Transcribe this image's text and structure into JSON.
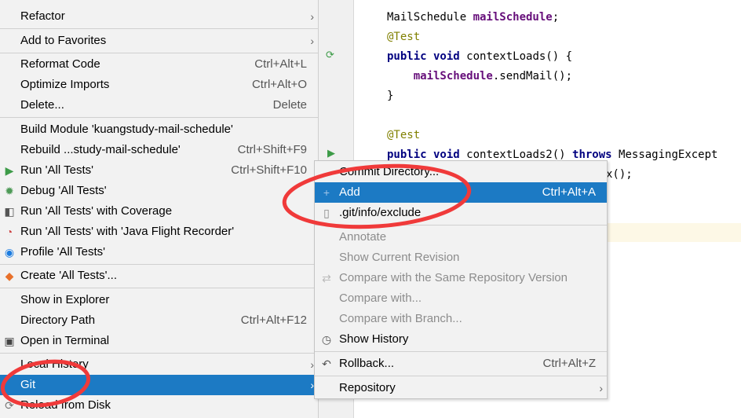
{
  "editor": {
    "lines": [
      {
        "parts": [
          {
            "t": "MailSchedule ",
            "c": ""
          },
          {
            "t": "mailSchedule",
            "c": "fld"
          },
          {
            "t": ";",
            "c": ""
          }
        ]
      },
      {
        "parts": [
          {
            "t": "@Test",
            "c": "ann"
          }
        ]
      },
      {
        "parts": [
          {
            "t": "public void ",
            "c": "kw"
          },
          {
            "t": "contextLoads() {",
            "c": ""
          }
        ]
      },
      {
        "parts": [
          {
            "t": "    ",
            "c": ""
          },
          {
            "t": "mailSchedule",
            "c": "fld"
          },
          {
            "t": ".sendMail();",
            "c": ""
          }
        ]
      },
      {
        "parts": [
          {
            "t": "}",
            "c": ""
          }
        ]
      },
      {
        "parts": [
          {
            "t": "@Test",
            "c": "ann"
          }
        ]
      },
      {
        "parts": [
          {
            "t": "public void ",
            "c": "kw"
          },
          {
            "t": "contextLoads2() ",
            "c": ""
          },
          {
            "t": "throws ",
            "c": "kw"
          },
          {
            "t": "MessagingExcept",
            "c": ""
          }
        ]
      },
      {
        "parts": [
          {
            "t": "x();",
            "c": ""
          }
        ]
      }
    ]
  },
  "context_menu": {
    "items": [
      {
        "label": "Refactor",
        "submenu": true
      },
      {
        "separator": true
      },
      {
        "label": "Add to Favorites",
        "submenu": true
      },
      {
        "separator": true
      },
      {
        "label": "Reformat Code",
        "shortcut": "Ctrl+Alt+L"
      },
      {
        "label": "Optimize Imports",
        "shortcut": "Ctrl+Alt+O"
      },
      {
        "label": "Delete...",
        "shortcut": "Delete"
      },
      {
        "separator": true
      },
      {
        "label": "Build Module 'kuangstudy-mail-schedule'"
      },
      {
        "label": "Rebuild ...study-mail-schedule'",
        "shortcut": "Ctrl+Shift+F9"
      },
      {
        "label": "Run 'All Tests'",
        "shortcut": "Ctrl+Shift+F10",
        "icon": "run-icon"
      },
      {
        "label": "Debug 'All Tests'",
        "icon": "debug-icon"
      },
      {
        "label": "Run 'All Tests' with Coverage",
        "icon": "coverage-icon"
      },
      {
        "label": "Run 'All Tests' with 'Java Flight Recorder'",
        "icon": "flight-recorder-icon"
      },
      {
        "label": "Profile 'All Tests'",
        "icon": "profile-icon"
      },
      {
        "separator": true
      },
      {
        "label": "Create 'All Tests'...",
        "icon": "create-test-icon"
      },
      {
        "separator": true
      },
      {
        "label": "Show in Explorer"
      },
      {
        "label": "Directory Path",
        "shortcut": "Ctrl+Alt+F12"
      },
      {
        "label": "Open in Terminal",
        "icon": "terminal-icon"
      },
      {
        "separator": true
      },
      {
        "label": "Local History",
        "submenu": true
      },
      {
        "label": "Git",
        "submenu": true,
        "selected": true
      },
      {
        "label": "Reload from Disk",
        "icon": "reload-icon"
      }
    ]
  },
  "git_submenu": {
    "items": [
      {
        "label": "Commit Directory..."
      },
      {
        "label": "Add",
        "shortcut": "Ctrl+Alt+A",
        "icon": "plus-icon",
        "selected": true
      },
      {
        "label": ".git/info/exclude",
        "icon": "ignore-file-icon"
      },
      {
        "separator": true
      },
      {
        "label": "Annotate",
        "disabled": true
      },
      {
        "label": "Show Current Revision",
        "disabled": true
      },
      {
        "label": "Compare with the Same Repository Version",
        "disabled": true,
        "icon": "compare-icon"
      },
      {
        "label": "Compare with...",
        "disabled": true
      },
      {
        "label": "Compare with Branch...",
        "disabled": true
      },
      {
        "label": "Show History",
        "icon": "history-icon"
      },
      {
        "separator": true
      },
      {
        "label": "Rollback...",
        "shortcut": "Ctrl+Alt+Z",
        "icon": "rollback-icon"
      },
      {
        "separator": true
      },
      {
        "label": "Repository",
        "submenu": true
      }
    ]
  },
  "colors": {
    "selection": "#1c7ac4",
    "annotation_marks": "#f03a3a",
    "menu_bg": "#f2f2f2"
  }
}
